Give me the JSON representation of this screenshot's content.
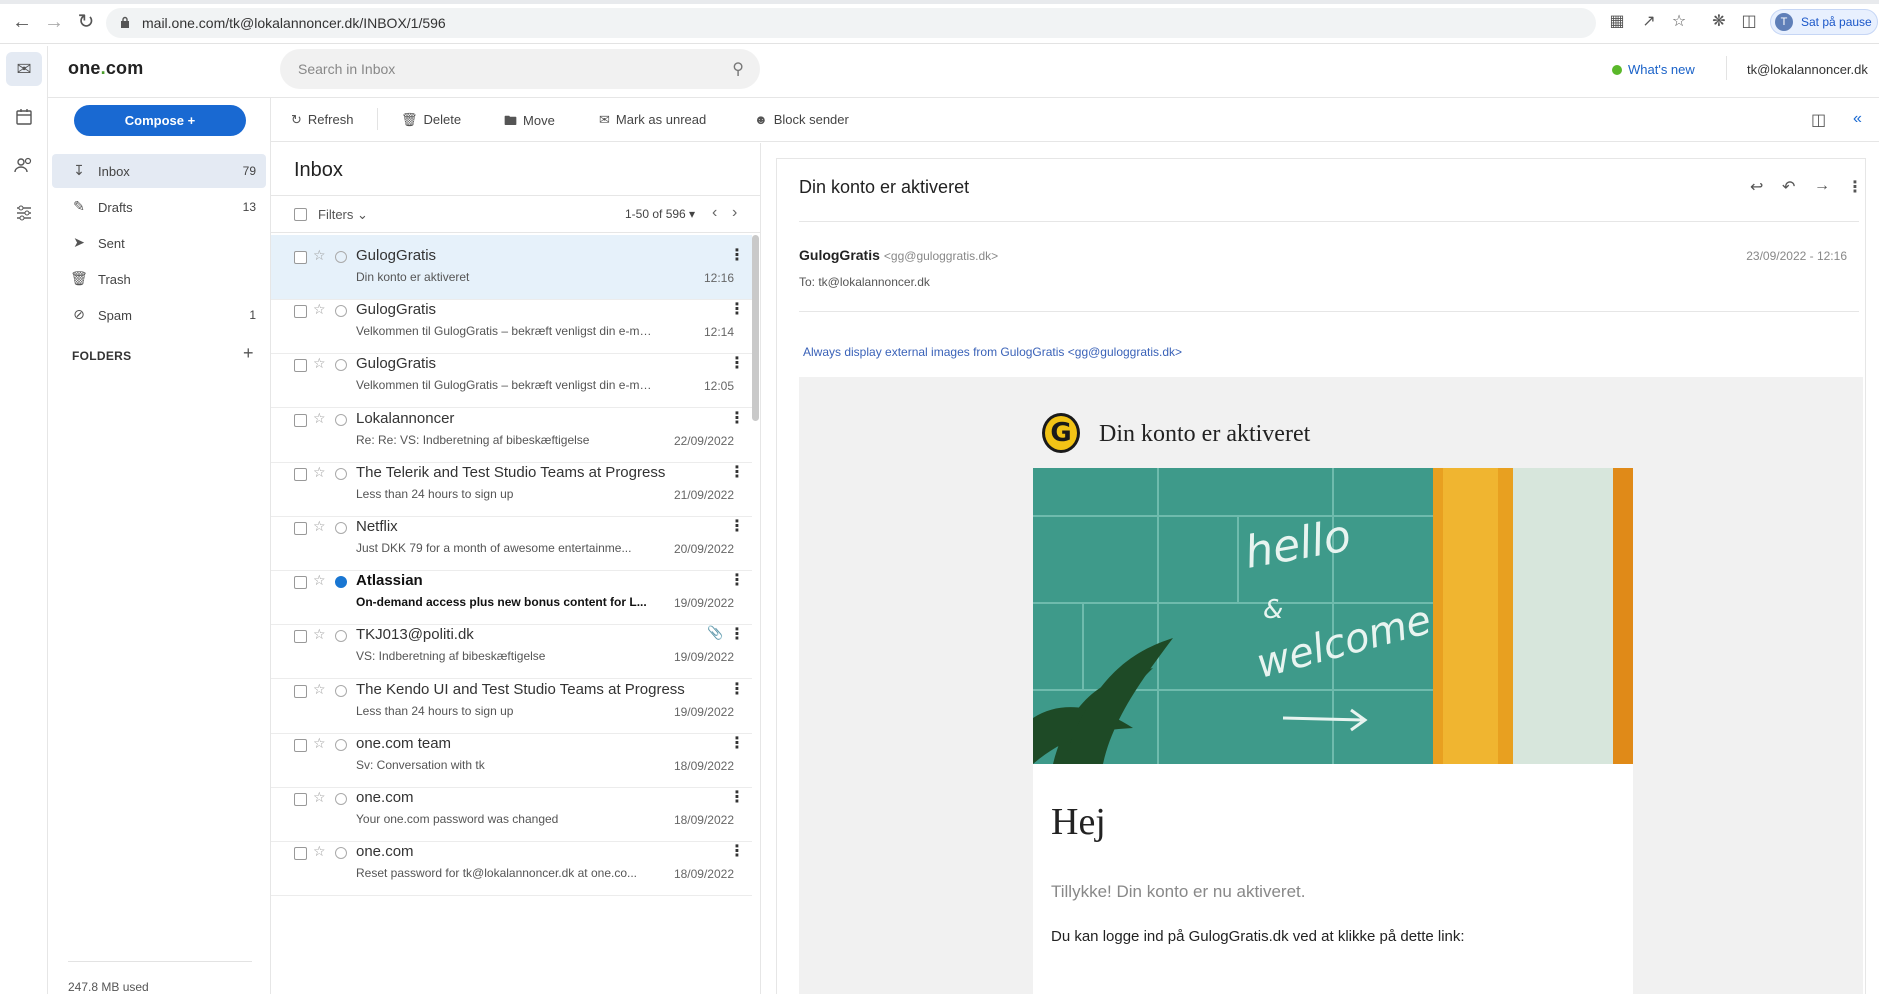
{
  "browser": {
    "url": "mail.one.com/tk@lokalannoncer.dk/INBOX/1/596",
    "profile_initial": "T",
    "profile_label": "Sat på pause"
  },
  "app": {
    "logo_text": "one",
    "logo_dot": ".",
    "logo_suffix": "com",
    "search_placeholder": "Search in Inbox",
    "whats_new": "What's new",
    "account": "tk@lokalannoncer.dk"
  },
  "sidebar": {
    "compose_label": "Compose",
    "items": [
      {
        "label": "Inbox",
        "count": "79",
        "icon": "inbox-icon"
      },
      {
        "label": "Drafts",
        "count": "13",
        "icon": "drafts-icon"
      },
      {
        "label": "Sent",
        "count": "",
        "icon": "sent-icon"
      },
      {
        "label": "Trash",
        "count": "",
        "icon": "trash-icon"
      },
      {
        "label": "Spam",
        "count": "1",
        "icon": "spam-icon"
      }
    ],
    "folders_label": "FOLDERS",
    "usage": "247.8 MB used"
  },
  "toolbar": {
    "refresh": "Refresh",
    "delete": "Delete",
    "move": "Move",
    "mark_unread": "Mark as unread",
    "block_sender": "Block sender"
  },
  "list": {
    "title": "Inbox",
    "filters": "Filters",
    "range": "1-50 of 596",
    "rows": [
      {
        "sender": "GulogGratis",
        "subject": "Din konto er aktiveret",
        "date": "12:16",
        "unread": false,
        "selected": true,
        "attachment": false
      },
      {
        "sender": "GulogGratis",
        "subject": "Velkommen til GulogGratis – bekræft venligst din e-mail...",
        "date": "12:14",
        "unread": false,
        "selected": false,
        "attachment": false
      },
      {
        "sender": "GulogGratis",
        "subject": "Velkommen til GulogGratis – bekræft venligst din e-mail...",
        "date": "12:05",
        "unread": false,
        "selected": false,
        "attachment": false
      },
      {
        "sender": "Lokalannoncer",
        "subject": "Re: Re: VS: Indberetning af bibeskæftigelse",
        "date": "22/09/2022",
        "unread": false,
        "selected": false,
        "attachment": false
      },
      {
        "sender": "The Telerik and Test Studio Teams at Progress",
        "subject": "Less than 24 hours to sign up",
        "date": "21/09/2022",
        "unread": false,
        "selected": false,
        "attachment": false
      },
      {
        "sender": "Netflix",
        "subject": "Just DKK 79 for a month of awesome entertainme...",
        "date": "20/09/2022",
        "unread": false,
        "selected": false,
        "attachment": false
      },
      {
        "sender": "Atlassian",
        "subject": "On-demand access plus new bonus content for L...",
        "date": "19/09/2022",
        "unread": true,
        "selected": false,
        "attachment": false
      },
      {
        "sender": "TKJ013@politi.dk",
        "subject": "VS: Indberetning af bibeskæftigelse",
        "date": "19/09/2022",
        "unread": false,
        "selected": false,
        "attachment": true
      },
      {
        "sender": "The Kendo UI and Test Studio Teams at Progress",
        "subject": "Less than 24 hours to sign up",
        "date": "19/09/2022",
        "unread": false,
        "selected": false,
        "attachment": false
      },
      {
        "sender": "one.com team",
        "subject": "Sv: Conversation with tk",
        "date": "18/09/2022",
        "unread": false,
        "selected": false,
        "attachment": false
      },
      {
        "sender": "one.com",
        "subject": "Your one.com password was changed",
        "date": "18/09/2022",
        "unread": false,
        "selected": false,
        "attachment": false
      },
      {
        "sender": "one.com",
        "subject": "Reset password for tk@lokalannoncer.dk at one.co...",
        "date": "18/09/2022",
        "unread": false,
        "selected": false,
        "attachment": false
      }
    ]
  },
  "reader": {
    "subject": "Din konto er aktiveret",
    "from_name": "GulogGratis",
    "from_email": "<gg@guloggratis.dk>",
    "datetime": "23/09/2022  -  12:16",
    "to": "To: tk@lokalannoncer.dk",
    "external_images": "Always display external images from GulogGratis <gg@guloggratis.dk>",
    "body": {
      "logo_letter": "G",
      "title": "Din konto er aktiveret",
      "image_text_1": "hello",
      "image_text_2": "&",
      "image_text_3": "welcome",
      "greeting": "Hej",
      "p1": "Tillykke! Din konto er nu aktiveret.",
      "p2": "Du kan logge ind på GulogGratis.dk ved at klikke på dette link:"
    }
  },
  "colors": {
    "accent": "#1969d2",
    "selected_row": "#e6f1fa",
    "unread_dot": "#1976d2",
    "brand_green": "#5ab82a",
    "gg_yellow": "#f2c316"
  }
}
